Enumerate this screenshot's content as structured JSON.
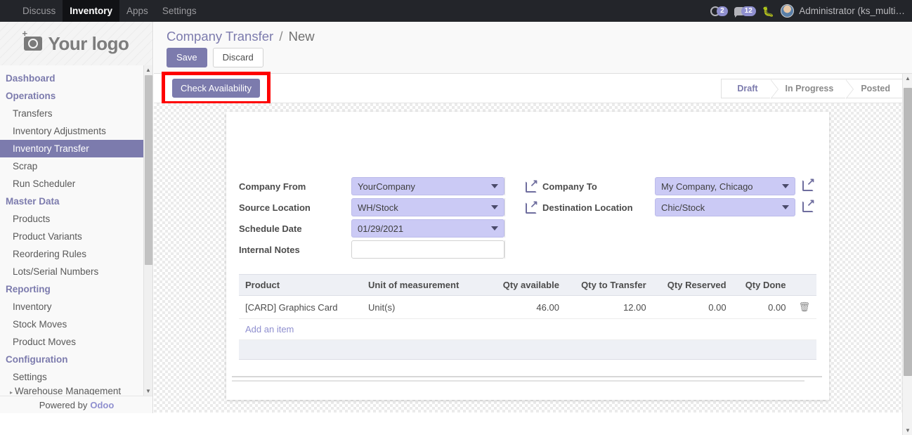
{
  "navbar": {
    "items": [
      {
        "label": "Discuss",
        "active": false
      },
      {
        "label": "Inventory",
        "active": true
      },
      {
        "label": "Apps",
        "active": false
      },
      {
        "label": "Settings",
        "active": false
      }
    ],
    "activity_badge": "2",
    "messages_badge": "12",
    "bug_icon": "bug-icon",
    "username": "Administrator (ks_multi…"
  },
  "sidebar": {
    "logo_text": "Your logo",
    "groups": [
      {
        "header": "Dashboard",
        "items": []
      },
      {
        "header": "Operations",
        "items": [
          {
            "label": "Transfers",
            "active": false
          },
          {
            "label": "Inventory Adjustments",
            "active": false
          },
          {
            "label": "Inventory Transfer",
            "active": true
          },
          {
            "label": "Scrap",
            "active": false
          },
          {
            "label": "Run Scheduler",
            "active": false
          }
        ]
      },
      {
        "header": "Master Data",
        "items": [
          {
            "label": "Products",
            "active": false
          },
          {
            "label": "Product Variants",
            "active": false
          },
          {
            "label": "Reordering Rules",
            "active": false
          },
          {
            "label": "Lots/Serial Numbers",
            "active": false
          }
        ]
      },
      {
        "header": "Reporting",
        "items": [
          {
            "label": "Inventory",
            "active": false
          },
          {
            "label": "Stock Moves",
            "active": false
          },
          {
            "label": "Product Moves",
            "active": false
          }
        ]
      },
      {
        "header": "Configuration",
        "items": [
          {
            "label": "Settings",
            "active": false
          }
        ]
      }
    ],
    "truncated_item": "Warehouse Management",
    "powered_by": "Powered by",
    "powered_brand": "Odoo"
  },
  "control_panel": {
    "breadcrumb_root": "Company Transfer",
    "breadcrumb_sep": "/",
    "breadcrumb_current": "New",
    "save_label": "Save",
    "discard_label": "Discard"
  },
  "action_bar": {
    "check_availability_label": "Check Availability",
    "highlight_color": "#fe0000",
    "statuses": [
      {
        "label": "Draft",
        "active": true
      },
      {
        "label": "In Progress",
        "active": false
      },
      {
        "label": "Posted",
        "active": false
      }
    ]
  },
  "form": {
    "left": [
      {
        "label": "Company From",
        "value": "YourCompany",
        "type": "select"
      },
      {
        "label": "Source Location",
        "value": "WH/Stock",
        "type": "select"
      },
      {
        "label": "Schedule Date",
        "value": "01/29/2021",
        "type": "select"
      },
      {
        "label": "Internal Notes",
        "value": "",
        "type": "text"
      }
    ],
    "right": [
      {
        "label": "Company To",
        "value": "My Company, Chicago",
        "type": "select"
      },
      {
        "label": "Destination Location",
        "value": "Chic/Stock",
        "type": "select"
      }
    ]
  },
  "lines": {
    "columns": [
      "Product",
      "Unit of measurement",
      "Qty available",
      "Qty to Transfer",
      "Qty Reserved",
      "Qty Done"
    ],
    "rows": [
      {
        "product": "[CARD] Graphics Card",
        "uom": "Unit(s)",
        "qty_available": "46.00",
        "qty_to_transfer": "12.00",
        "qty_reserved": "0.00",
        "qty_done": "0.00",
        "delete_icon": "trash-icon"
      }
    ],
    "add_item_label": "Add an item"
  },
  "colors": {
    "accent": "#7c7bad",
    "navbar_bg": "#23252a",
    "field_bg": "#cbcaf5",
    "highlight": "#fe0000"
  }
}
